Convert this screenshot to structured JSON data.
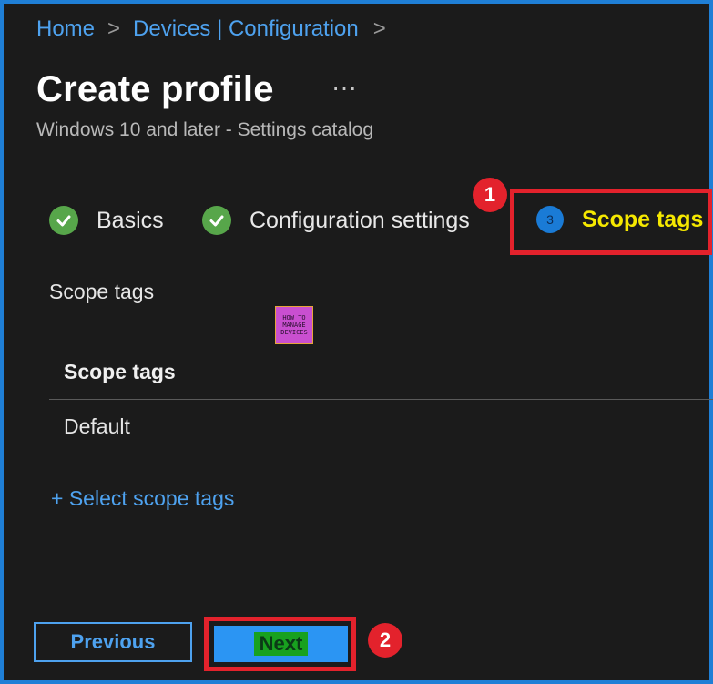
{
  "breadcrumb": {
    "home": "Home",
    "devices": "Devices | Configuration",
    "separator": ">"
  },
  "page": {
    "title": "Create profile",
    "more": "···",
    "subtitle": "Windows 10 and later - Settings catalog"
  },
  "steps": [
    {
      "label": "Basics",
      "state": "complete"
    },
    {
      "label": "Configuration settings",
      "state": "complete"
    },
    {
      "number": "3",
      "label": "Scope tags",
      "state": "active"
    }
  ],
  "callouts": {
    "first": "1",
    "second": "2"
  },
  "section": {
    "label": "Scope tags"
  },
  "logo": {
    "line1": "HOW TO",
    "line2": "MANAGE",
    "line3": "DEVICES"
  },
  "table": {
    "header": "Scope tags",
    "rows": [
      "Default"
    ]
  },
  "select_link": "+ Select scope tags",
  "footer": {
    "previous": "Previous",
    "next": "Next"
  },
  "colors": {
    "accent": "#1f7fd6",
    "link": "#4ea2ef",
    "complete": "#57a64a",
    "highlight": "#e3222c",
    "active_label": "#f5e800"
  }
}
